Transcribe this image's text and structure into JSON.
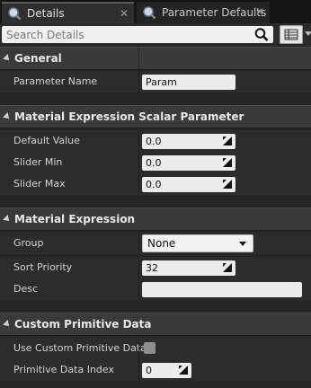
{
  "tabs": [
    {
      "label": "Details",
      "icon": "search-icon",
      "close": "✕"
    },
    {
      "label": "Parameter Defaults",
      "icon": "search-icon",
      "close": "✕"
    }
  ],
  "search": {
    "placeholder": "Search Details"
  },
  "categories": {
    "general": {
      "title": "General",
      "rows": {
        "parameter_name": {
          "label": "Parameter Name",
          "value": "Param"
        }
      }
    },
    "scalar": {
      "title": "Material Expression Scalar Parameter",
      "rows": {
        "default_value": {
          "label": "Default Value",
          "value": "0.0"
        },
        "slider_min": {
          "label": "Slider Min",
          "value": "0.0"
        },
        "slider_max": {
          "label": "Slider Max",
          "value": "0.0"
        }
      }
    },
    "expression": {
      "title": "Material Expression",
      "rows": {
        "group": {
          "label": "Group",
          "value": "None"
        },
        "sort_priority": {
          "label": "Sort Priority",
          "value": "32"
        },
        "desc": {
          "label": "Desc",
          "value": ""
        }
      }
    },
    "custom": {
      "title": "Custom Primitive Data",
      "rows": {
        "use_custom": {
          "label": "Use Custom Primitive Data",
          "checked": false
        },
        "data_index": {
          "label": "Primitive Data Index",
          "value": "0"
        }
      }
    }
  },
  "colors": {
    "panel_bg": "#262626",
    "category_bg": "#3a3a3a",
    "field_bg": "#ececec"
  }
}
